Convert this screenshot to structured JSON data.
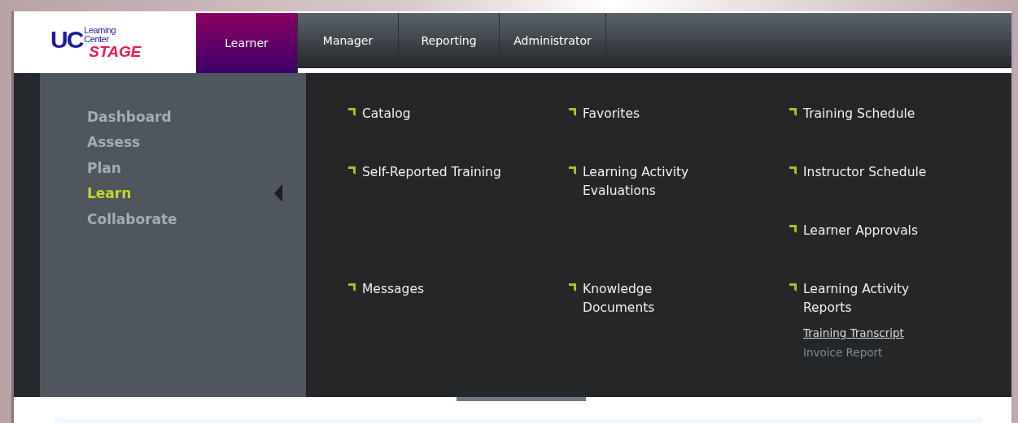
{
  "logo": {
    "mark": "UC",
    "line_1": "Learning",
    "line_2": "Center",
    "stage": "STAGE"
  },
  "tabs": [
    {
      "label": "Learner",
      "selected": true
    },
    {
      "label": "Manager",
      "selected": false
    },
    {
      "label": "Reporting",
      "selected": false
    },
    {
      "label": "Administrator",
      "selected": false
    }
  ],
  "sidebar": {
    "items": [
      {
        "label": "Dashboard",
        "selected": false
      },
      {
        "label": "Assess",
        "selected": false
      },
      {
        "label": "Plan",
        "selected": false
      },
      {
        "label": "Learn",
        "selected": true
      },
      {
        "label": "Collaborate",
        "selected": false
      }
    ]
  },
  "menu_rows": [
    [
      {
        "label": "Catalog"
      },
      {
        "label": "Favorites"
      },
      {
        "label": "Training Schedule"
      }
    ],
    [
      {
        "label": "Self-Reported Training"
      },
      {
        "label": "Learning Activity Evaluations"
      },
      {
        "label": "Instructor Schedule"
      }
    ],
    [
      null,
      null,
      {
        "label": "Learner Approvals"
      }
    ],
    [
      {
        "label": "Messages"
      },
      {
        "label": "Knowledge Documents"
      },
      {
        "label": "Learning Activity Reports",
        "sublinks": [
          {
            "label": "Training Transcript",
            "hovered": true
          },
          {
            "label": "Invoice Report",
            "hovered": false
          }
        ]
      }
    ]
  ]
}
